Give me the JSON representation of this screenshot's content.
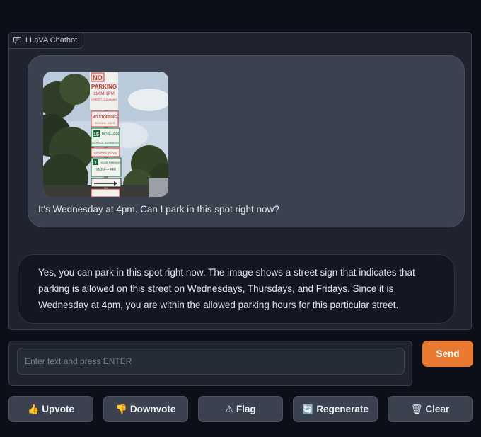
{
  "panel": {
    "label": "LLaVA Chatbot",
    "label_icon": "chat-icon"
  },
  "conversation": {
    "user_message": "It's Wednesday at 4pm. Can I park in this spot right now?",
    "bot_message": "Yes, you can park in this spot right now. The image shows a street sign that indicates that parking is allowed on this street on Wednesdays, Thursdays, and Fridays. Since it is Wednesday at 4pm, you are within the allowed parking hours for this particular street.",
    "image_signs": {
      "no_parking": "NO PARKING",
      "hours": "11AM - 1PM",
      "street_cleaning": "STREET CLEANING",
      "school_days": "SCHOOL DAYS",
      "mon_fri": "MON — FRI",
      "limit": "15",
      "one_hour": "1 HOUR PARKING",
      "days": "MON — FRI"
    }
  },
  "input": {
    "placeholder": "Enter text and press ENTER",
    "value": ""
  },
  "send_label": "Send",
  "actions": [
    {
      "icon": "👍",
      "icon_name": "thumbs-up-icon",
      "label": "Upvote"
    },
    {
      "icon": "👎",
      "icon_name": "thumbs-down-icon",
      "label": "Downvote"
    },
    {
      "icon": "⚠",
      "icon_name": "warning-icon",
      "label": "Flag"
    },
    {
      "icon": "🔄",
      "icon_name": "refresh-icon",
      "label": "Regenerate"
    },
    {
      "icon": "🗑",
      "icon_name": "trash-icon",
      "label": "Clear"
    }
  ],
  "colors": {
    "accent": "#e8792f",
    "background": "#0c0f17",
    "panel": "#1f2330",
    "user_bubble": "#3b414f",
    "bot_bubble": "#131722"
  }
}
